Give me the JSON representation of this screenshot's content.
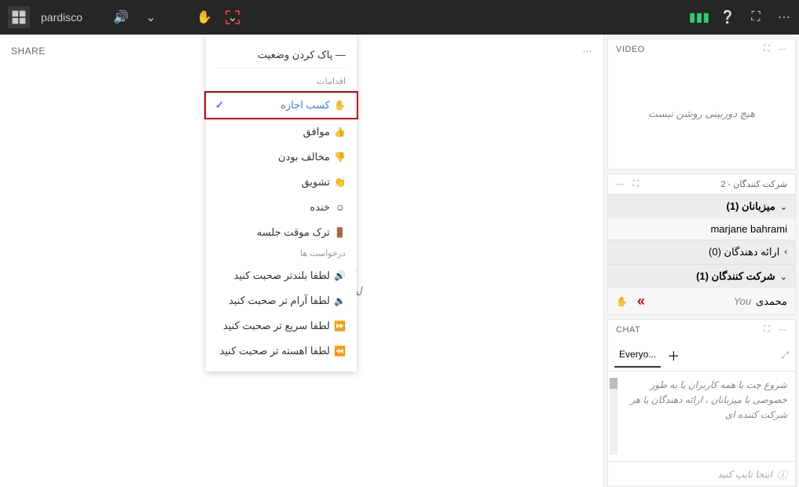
{
  "header": {
    "title": "pardisco"
  },
  "share": {
    "label": "SHARE"
  },
  "stage": {
    "big": "چیزی به                  شده",
    "sub": "لطفا منتظر بمانی                    وع کند"
  },
  "dropdown": {
    "clear": "پاک کردن وضعیت",
    "sectionActions": "اقدامات",
    "sectionRequests": "درخواست ها",
    "items1": [
      {
        "label": "کسب اجازه",
        "icon": "✋",
        "selected": true
      },
      {
        "label": "موافق",
        "icon": "👍"
      },
      {
        "label": "مخالف بودن",
        "icon": "👎"
      },
      {
        "label": "تشویق",
        "icon": "👏"
      },
      {
        "label": "خنده",
        "icon": "☺"
      },
      {
        "label": "ترک موقت جلسه",
        "icon": "🚪"
      }
    ],
    "items2": [
      {
        "label": "لطفا بلندتر صحبت کنید",
        "icon": "🔊"
      },
      {
        "label": "لطفا آرام تر صحبت کنید",
        "icon": "🔉"
      },
      {
        "label": "لطفا سریع تر صحبت کنید",
        "icon": "⏩"
      },
      {
        "label": "لطفا اهسته تر صحبت کنید",
        "icon": "⏪"
      }
    ]
  },
  "video": {
    "label": "VIDEO",
    "empty": "هیچ دوربینی روشن نیست"
  },
  "attendees": {
    "label": "شرکت کنندگان  - 2",
    "hosts": {
      "label": "میزبانان (1)",
      "entries": [
        "marjane bahrami"
      ]
    },
    "presenters": {
      "label": "ارائه دهندگان (0)"
    },
    "participants": {
      "label": "شرکت کنندگان (1)",
      "entries": [
        {
          "name": "محمدی",
          "you": "You"
        }
      ]
    }
  },
  "chat": {
    "label": "CHAT",
    "tab": "Everyo...",
    "body": "شروع چت با همه کاربران یا به طور خصوصی با میزبانان ، ارائه دهندگان یا هر شرکت کننده ای",
    "placeholder": "اینجا تایپ کنید"
  }
}
